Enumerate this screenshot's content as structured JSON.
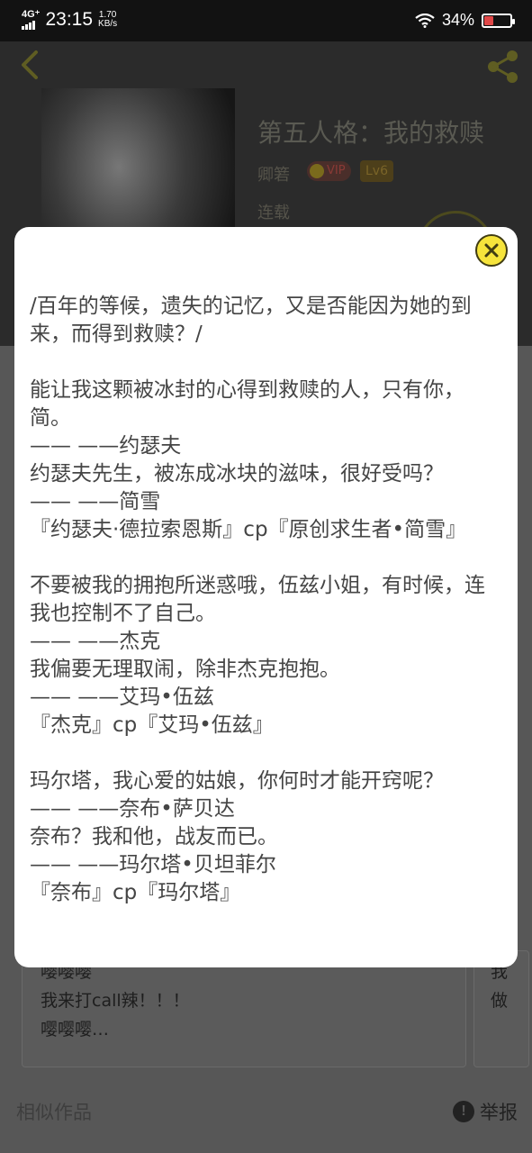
{
  "status_bar": {
    "network": "4G⁺",
    "time": "23:15",
    "speed_value": "1.70",
    "speed_unit": "KB/s",
    "battery_percent": "34%",
    "battery_level": 0.34,
    "battery_color": "#e04848"
  },
  "book": {
    "title": "第五人格：我的救赎",
    "author": "卿箬",
    "vip_label": "VIP",
    "level_label": "Lv6",
    "status": "连载"
  },
  "modal": {
    "lines": [
      "/百年的等候，遗失的记忆，又是否能因为她的到来，而得到救赎？/",
      "",
      "能让我这颗被冰封的心得到救赎的人，只有你，简。",
      "—— ——约瑟夫",
      "约瑟夫先生，被冻成冰块的滋味，很好受吗？",
      "—— ——简雪",
      "『约瑟夫·德拉索恩斯』cp『原创求生者•简雪』",
      "",
      "不要被我的拥抱所迷惑哦，伍兹小姐，有时候，连我也控制不了自己。",
      "—— ——杰克",
      "我偏要无理取闹，除非杰克抱抱。",
      "—— ——艾玛•伍兹",
      "『杰克』cp『艾玛•伍兹』",
      "",
      "玛尔塔，我心爱的姑娘，你何时才能开窍呢？",
      "—— ——奈布•萨贝达",
      "奈布？我和他，战友而已。",
      "—— ——玛尔塔•贝坦菲尔",
      "『奈布』cp『玛尔塔』"
    ]
  },
  "comments": {
    "first": {
      "line1": "嘤嘤嘤",
      "line2": "我来打call辣！！！",
      "line3": "嘤嘤嘤…"
    },
    "second": {
      "line1": "我",
      "line2": "做"
    }
  },
  "footer": {
    "similar_label": "相似作品",
    "report_label": "举报",
    "report_icon": "!"
  },
  "icons": {
    "back": "back-arrow-icon",
    "share": "share-icon",
    "close": "close-icon",
    "report": "exclamation-icon"
  },
  "colors": {
    "accent_yellow": "#f6e43b",
    "modal_text": "#454545"
  }
}
